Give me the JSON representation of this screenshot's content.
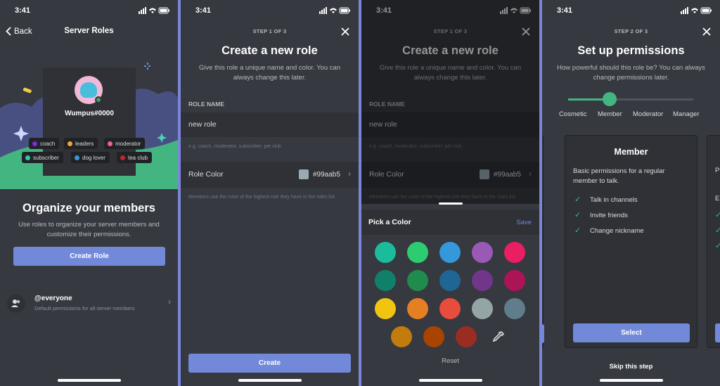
{
  "status_time": "3:41",
  "p1": {
    "back_label": "Back",
    "nav_title": "Server Roles",
    "username": "Wumpus#0000",
    "tags": [
      {
        "label": "coach",
        "color": "#7e2ae0"
      },
      {
        "label": "leaders",
        "color": "#f0a43a"
      },
      {
        "label": "moderator",
        "color": "#f06292"
      },
      {
        "label": "subscriber",
        "color": "#2ecc9f"
      },
      {
        "label": "dog lover",
        "color": "#3498db"
      },
      {
        "label": "tea club",
        "color": "#c0272d"
      }
    ],
    "heading": "Organize your members",
    "subtitle": "Use roles to organize your server members and customize their permissions.",
    "create_role_label": "Create Role",
    "everyone_name": "@everyone",
    "everyone_desc": "Default permissions for all server members"
  },
  "p2": {
    "step": "STEP 1 OF 3",
    "title": "Create a new role",
    "subtitle": "Give this role a unique name and color. You can always change this later.",
    "role_name_label": "ROLE NAME",
    "role_name_value": "new role",
    "role_name_hint": "e.g. coach, moderator, subscriber, pet club",
    "role_color_label": "Role Color",
    "role_color_hex": "#99aab5",
    "role_color_hint": "Members use the color of the highest role they have in the roles list.",
    "create_label": "Create"
  },
  "p3": {
    "step": "STEP 1 OF 3",
    "title": "Create a new role",
    "subtitle": "Give this role a unique name and color. You can always change this later.",
    "role_name_label": "ROLE NAME",
    "role_name_value": "new role",
    "role_name_hint": "e.g. coach, moderator, subscriber, pet club",
    "role_color_label": "Role Color",
    "role_color_hex": "#99aab5",
    "role_color_hint": "Members use the color of the highest role they have in the roles list.",
    "pick_color_label": "Pick a Color",
    "save_label": "Save",
    "reset_label": "Reset",
    "colors": [
      "#1abc9c",
      "#2ecc71",
      "#3498db",
      "#9b59b6",
      "#e91e63",
      "#11806a",
      "#1f8b4c",
      "#206694",
      "#71368a",
      "#ad1457",
      "#f1c40f",
      "#e67e22",
      "#e74c3c",
      "#95a5a6",
      "#607d8b",
      "#c27c0e",
      "#a84300",
      "#992d22"
    ]
  },
  "p4": {
    "step": "STEP 2 OF 3",
    "title": "Set up permissions",
    "subtitle": "How powerful should this role be? You can always change permissions later.",
    "levels": [
      "Cosmetic",
      "Member",
      "Moderator",
      "Manager"
    ],
    "selected_level_fraction": 0.33,
    "card_title": "Member",
    "card_desc": "Basic permissions for a regular member to talk.",
    "perms": [
      "Talk in channels",
      "Invite friends",
      "Change nickname"
    ],
    "select_label": "Select",
    "skip_label": "Skip this step",
    "peek_right": "P",
    "peek_right2": "E"
  }
}
